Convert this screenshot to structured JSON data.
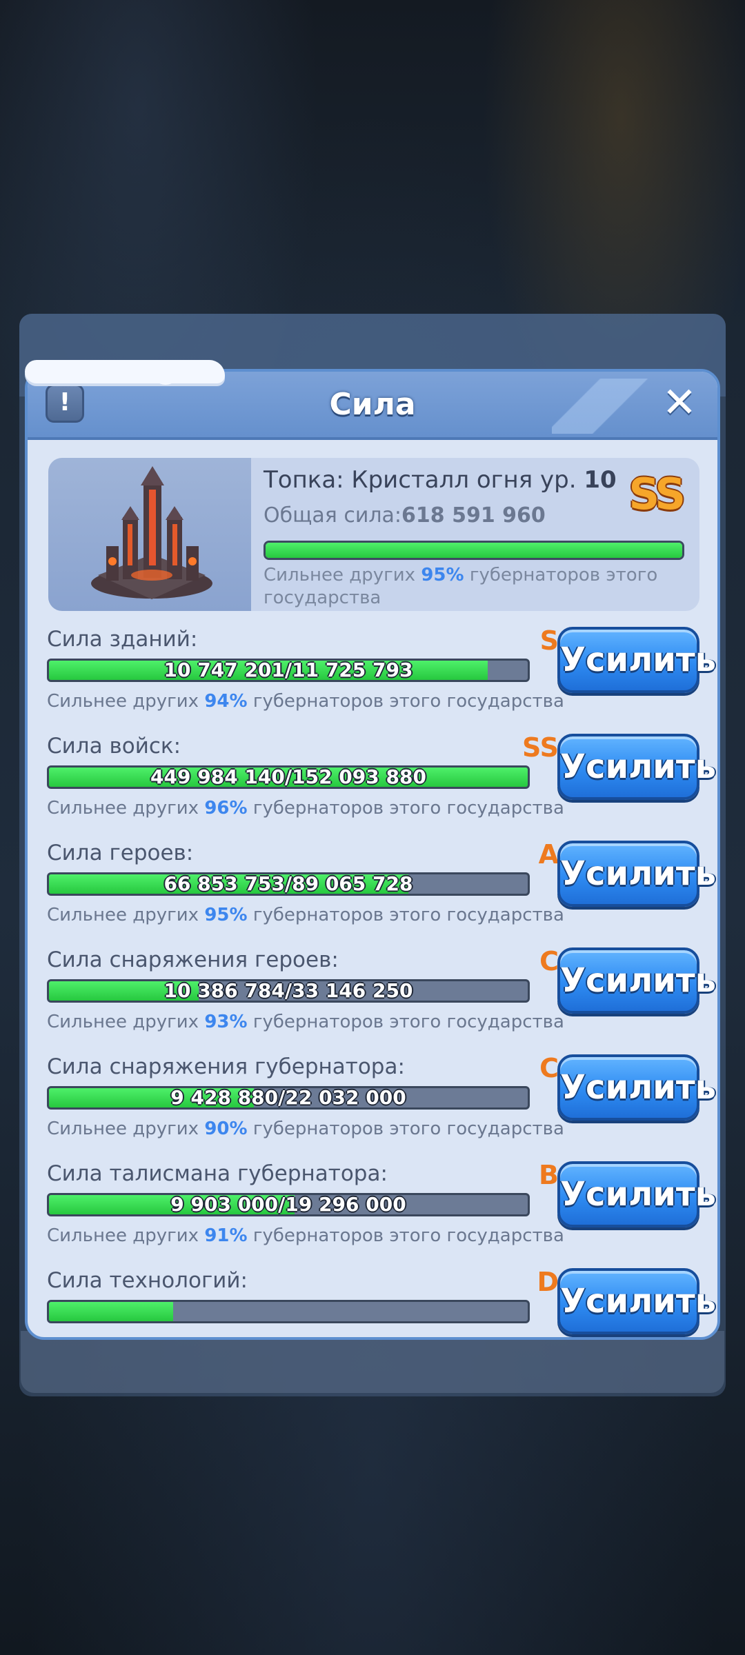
{
  "dialog": {
    "title": "Сила",
    "info_icon": "!",
    "close_icon": "✕"
  },
  "summary": {
    "building_label": "Топка: Кристалл огня ур. ",
    "building_level": "10",
    "grade": "SS",
    "total_label": "Общая сила:",
    "total_value": "618 591 960",
    "progress": 1.0,
    "desc_prefix": "Сильнее других ",
    "desc_pct": "95%",
    "desc_suffix": " губернаторов этого государства"
  },
  "stats": [
    {
      "label": "Сила зданий:",
      "grade": "S",
      "bar_text": "10 747 201/11 725 793",
      "fill": 0.917,
      "desc_prefix": "Сильнее других ",
      "pct": "94%",
      "desc_suffix": " губернаторов этого государства",
      "button": "Усилить"
    },
    {
      "label": "Сила войск:",
      "grade": "SS",
      "bar_text": "449 984 140/152 093 880",
      "fill": 1.0,
      "desc_prefix": "Сильнее других ",
      "pct": "96%",
      "desc_suffix": " губернаторов этого государства",
      "button": "Усилить"
    },
    {
      "label": "Сила героев:",
      "grade": "A",
      "bar_text": "66 853 753/89 065 728",
      "fill": 0.751,
      "desc_prefix": "Сильнее других ",
      "pct": "95%",
      "desc_suffix": " губернаторов этого государства",
      "button": "Усилить"
    },
    {
      "label": "Сила снаряжения героев:",
      "grade": "C",
      "bar_text": "10 386 784/33 146 250",
      "fill": 0.313,
      "desc_prefix": "Сильнее других ",
      "pct": "93%",
      "desc_suffix": " губернаторов этого государства",
      "button": "Усилить"
    },
    {
      "label": "Сила снаряжения губернатора:",
      "grade": "C",
      "bar_text": "9 428 880/22 032 000",
      "fill": 0.428,
      "desc_prefix": "Сильнее других ",
      "pct": "90%",
      "desc_suffix": " губернаторов этого государства",
      "button": "Усилить"
    },
    {
      "label": "Сила талисмана губернатора:",
      "grade": "B",
      "bar_text": "9 903 000/19 296 000",
      "fill": 0.513,
      "desc_prefix": "Сильнее других ",
      "pct": "91%",
      "desc_suffix": " губернаторов этого государства",
      "button": "Усилить"
    },
    {
      "label": "Сила технологий:",
      "grade": "D",
      "bar_text": "",
      "fill": 0.26,
      "desc_prefix": "",
      "pct": "",
      "desc_suffix": "",
      "button": "Усилить"
    }
  ],
  "colors": {
    "accent": "#3d86ee",
    "grade": "#ee7a1f",
    "bar_fill": "#2fd64a",
    "button": "#2e8bf2"
  }
}
